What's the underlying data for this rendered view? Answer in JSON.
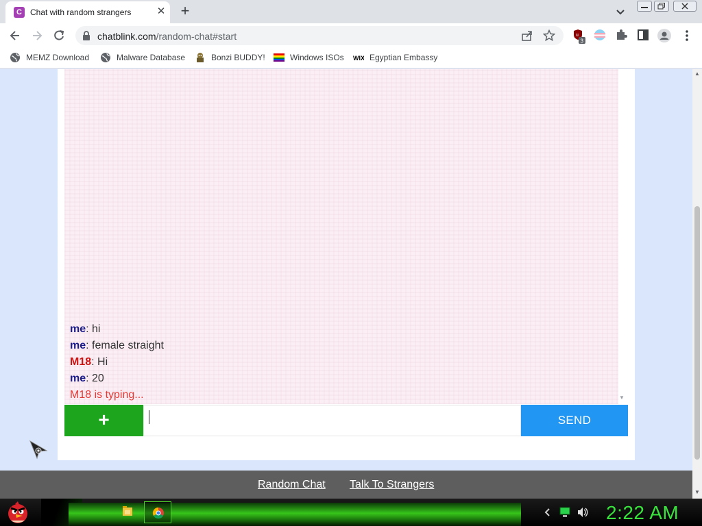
{
  "browser": {
    "tab": {
      "favicon_letter": "C",
      "title": "Chat with random strangers",
      "favicon_color": "#a43fb4"
    },
    "omnibox": {
      "host": "chatblink.com",
      "path": "/random-chat#start"
    },
    "extension_badge": "3",
    "bookmarks": [
      {
        "label": "MEMZ Download",
        "icon": "globe-icon"
      },
      {
        "label": "Malware Database",
        "icon": "globe-icon"
      },
      {
        "label": "Bonzi BUDDY!",
        "icon": "bonzi-icon"
      },
      {
        "label": "Windows ISOs",
        "icon": "rainbow-flag-icon"
      },
      {
        "label": "Egyptian Embassy",
        "icon": "wix-icon"
      }
    ]
  },
  "chat": {
    "messages": [
      {
        "sender": "me",
        "text": ": hi"
      },
      {
        "sender": "me",
        "text": ": female straight"
      },
      {
        "sender": "M18",
        "text": ": Hi"
      },
      {
        "sender": "me",
        "text": ": 20"
      }
    ],
    "typing_indicator": "M18 is typing...",
    "add_label": "+",
    "input_value": "",
    "send_label": "SEND",
    "colors": {
      "me": "#1a1a8a",
      "stranger": "#cc1111",
      "send": "#2196f3",
      "add": "#1ea51e"
    }
  },
  "footer": {
    "links": [
      "Random Chat",
      "Talk To Strangers"
    ]
  },
  "taskbar": {
    "clock": "2:22 AM",
    "apps": [
      "file-explorer-icon",
      "chrome-icon"
    ],
    "start_icon": "angry-bird-icon"
  }
}
